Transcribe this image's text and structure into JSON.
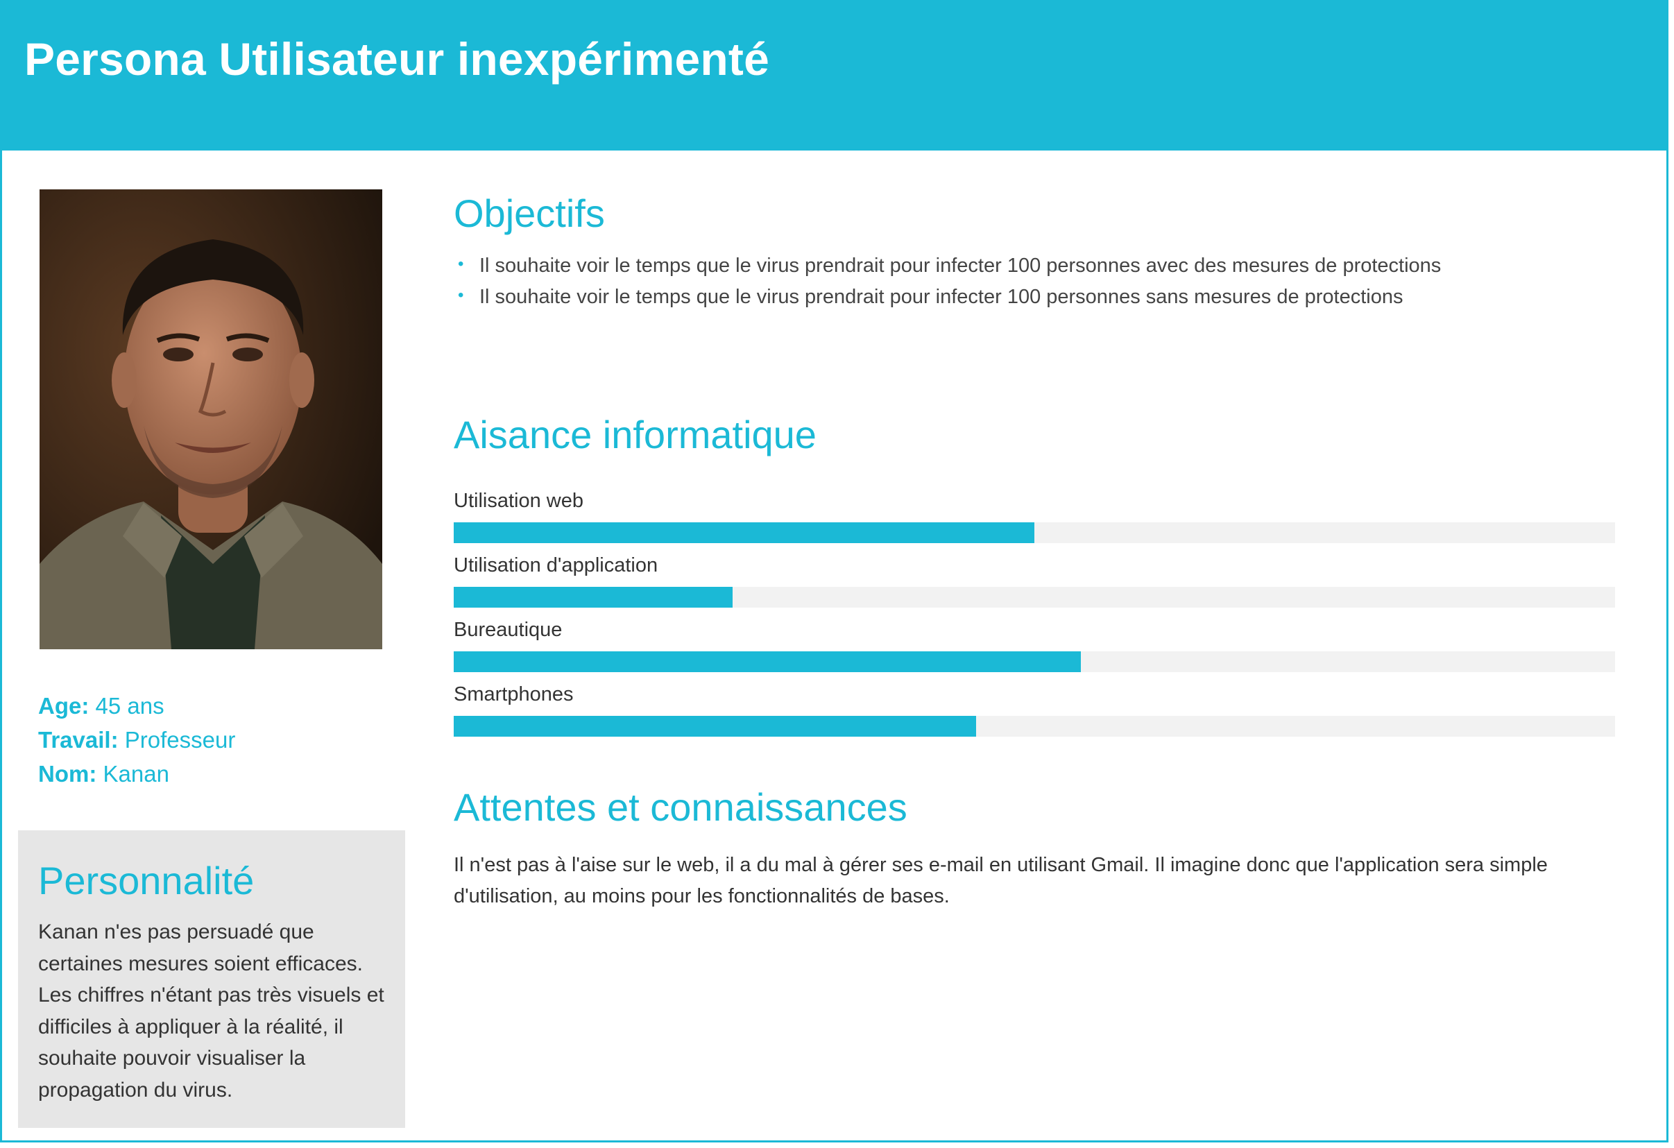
{
  "header": {
    "title": "Persona Utilisateur inexpérimenté"
  },
  "profile": {
    "photo_alt": "Portrait",
    "fields": [
      {
        "key": "Age:",
        "value": "45 ans"
      },
      {
        "key": "Travail:",
        "value": "Professeur"
      },
      {
        "key": "Nom:",
        "value": "Kanan"
      }
    ]
  },
  "personality": {
    "title": "Personnalité",
    "text": "Kanan n'es pas persuadé que certaines mesures soient efficaces. Les chiffres n'étant pas très visuels et difficiles à appliquer à la réalité, il souhaite pouvoir visualiser la propagation du virus."
  },
  "objectives": {
    "title": "Objectifs",
    "items": [
      "Il souhaite voir le temps que le virus prendrait pour infecter 100 personnes avec des mesures de protections",
      "Il souhaite voir le temps que le virus prendrait pour infecter 100 personnes sans mesures de protections"
    ]
  },
  "skills": {
    "title": "Aisance informatique",
    "items": [
      {
        "label": "Utilisation web",
        "level": 0.5
      },
      {
        "label": "Utilisation d'application",
        "level": 0.24
      },
      {
        "label": "Bureautique",
        "level": 0.54
      },
      {
        "label": "Smartphones",
        "level": 0.45
      }
    ]
  },
  "expectations": {
    "title": "Attentes et connaissances",
    "text": "Il n'est pas à l'aise sur le web, il a du mal à gérer ses e-mail en utilisant Gmail. Il imagine donc que l'application sera simple d'utilisation, au moins pour les fonctionnalités de bases."
  },
  "colors": {
    "accent": "#1bb9d6",
    "track": "#f2f2f2",
    "panel": "#e6e6e6",
    "text": "#333333"
  }
}
